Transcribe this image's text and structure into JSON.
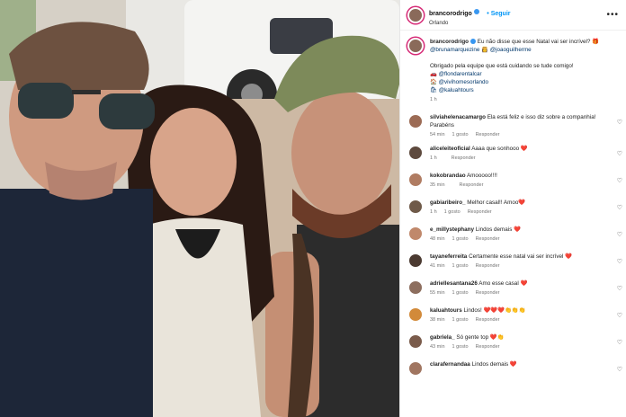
{
  "post": {
    "username": "brancorodrigo",
    "location": "Orlando",
    "follow_label": "Seguir",
    "more_label": "•••",
    "caption": {
      "username": "brancorodrigo",
      "line1": "Eu não disse que esse Natal vai ser incrível? 🎁",
      "tags1": "@brunamarquezine 👸 @joaoguilherme",
      "line2": "Obrigado pela equipe que está cuidando se tude comigo!",
      "tag_a": "🚗 @flondarentalcar",
      "tag_b": "🏠 @vivihomesorlando",
      "tag_c": "🛍 @kaluahtours",
      "time": "1 h"
    }
  },
  "comments": [
    {
      "user": "silviahelenacamargo",
      "text": "Ela está feliz e isso diz sobre a companhia! Parabéns",
      "time": "54 min",
      "likes": "1 gosto",
      "reply": "Responder"
    },
    {
      "user": "aliceleiteoficial",
      "text": "Aaaa que sonhooo ❤️",
      "time": "1 h",
      "likes": "",
      "reply": "Responder"
    },
    {
      "user": "kokobrandao",
      "text": "Amooooo!!!!",
      "time": "35 min",
      "likes": "",
      "reply": "Responder"
    },
    {
      "user": "gabiaribeiro_",
      "text": "Melhor casal!! Amoo❤️",
      "time": "1 h",
      "likes": "1 gosto",
      "reply": "Responder"
    },
    {
      "user": "e_millystephany",
      "text": "Lindos demais ❤️",
      "time": "48 min",
      "likes": "1 gosto",
      "reply": "Responder"
    },
    {
      "user": "tayaneferreita",
      "text": "Certamente esse natal vai ser incrível ❤️",
      "time": "41 min",
      "likes": "1 gosto",
      "reply": "Responder"
    },
    {
      "user": "adriellesantana26",
      "text": "Amo esse casal ❤️",
      "time": "55 min",
      "likes": "1 gosto",
      "reply": "Responder"
    },
    {
      "user": "kaluahtours",
      "text": "Lindos! ❤️❤️❤️👏👏👏",
      "time": "38 min",
      "likes": "1 gosto",
      "reply": "Responder"
    },
    {
      "user": "gabriela_",
      "text": "Só gente top ❤️👏",
      "time": "43 min",
      "likes": "1 gosto",
      "reply": "Responder"
    },
    {
      "user": "clarafernandaa",
      "text": "Lindos demais ❤️",
      "time": "",
      "likes": "",
      "reply": ""
    }
  ],
  "colors": {
    "accent": "#0095f6",
    "heart": "#ed4956",
    "tag": "#00376b"
  }
}
